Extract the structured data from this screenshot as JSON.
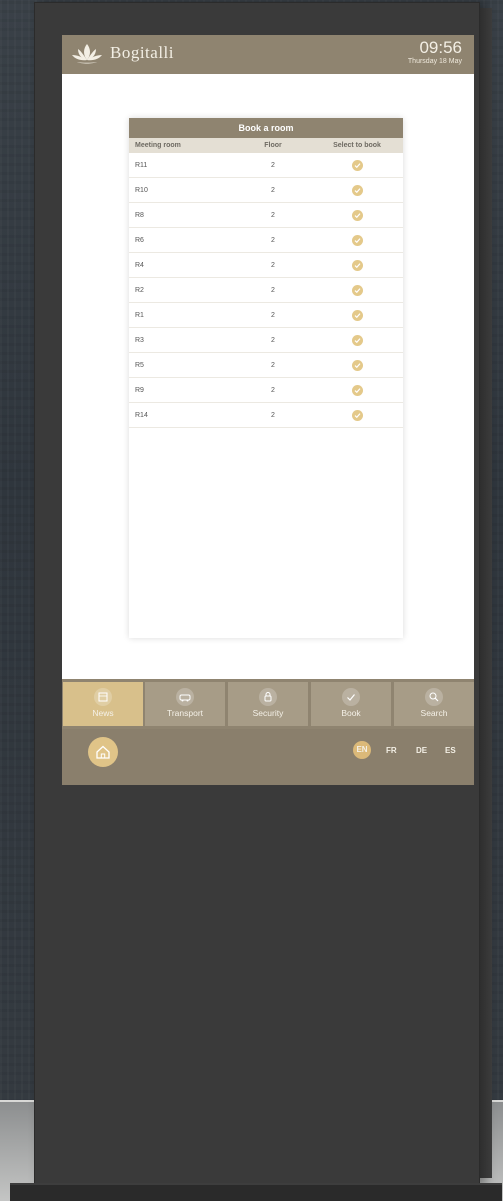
{
  "app": {
    "brand": "Bogitalli",
    "time": "09:56",
    "date": "Thursday 18 May"
  },
  "table": {
    "title": "Book a room",
    "headers": [
      "Meeting room",
      "Floor",
      "Select to book"
    ],
    "rows": [
      {
        "room": "R11",
        "floor": "2"
      },
      {
        "room": "R10",
        "floor": "2"
      },
      {
        "room": "R8",
        "floor": "2"
      },
      {
        "room": "R6",
        "floor": "2"
      },
      {
        "room": "R4",
        "floor": "2"
      },
      {
        "room": "R2",
        "floor": "2"
      },
      {
        "room": "R1",
        "floor": "2"
      },
      {
        "room": "R3",
        "floor": "2"
      },
      {
        "room": "R5",
        "floor": "2"
      },
      {
        "room": "R9",
        "floor": "2"
      },
      {
        "room": "R14",
        "floor": "2"
      }
    ]
  },
  "nav": {
    "items": [
      {
        "label": "News",
        "icon": "calendar-icon",
        "active": true
      },
      {
        "label": "Transport",
        "icon": "transport-icon",
        "active": false
      },
      {
        "label": "Security",
        "icon": "security-icon",
        "active": false
      },
      {
        "label": "Book",
        "icon": "check-icon",
        "active": false
      },
      {
        "label": "Search",
        "icon": "search-icon",
        "active": false
      }
    ]
  },
  "footer": {
    "home_icon": "home-icon",
    "languages": [
      {
        "code": "EN",
        "active": true
      },
      {
        "code": "FR",
        "active": false
      },
      {
        "code": "DE",
        "active": false
      },
      {
        "code": "ES",
        "active": false
      }
    ]
  },
  "colors": {
    "primary": "#8f8470",
    "accent": "#e0c488",
    "kiosk": "#3a3a3a"
  }
}
